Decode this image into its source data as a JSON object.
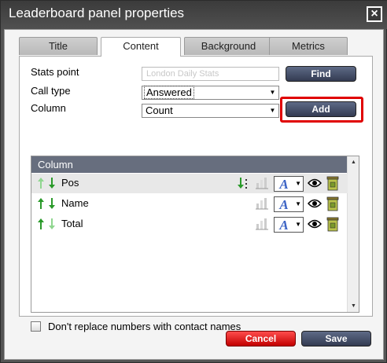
{
  "window": {
    "title": "Leaderboard panel properties",
    "close_label": "×"
  },
  "tabs": [
    {
      "label": "Title"
    },
    {
      "label": "Content"
    },
    {
      "label": "Background"
    },
    {
      "label": "Metrics"
    }
  ],
  "form": {
    "stats_point_label": "Stats point",
    "stats_point_placeholder": "London Daily Stats",
    "find_label": "Find",
    "call_type_label": "Call type",
    "call_type_value": "Answered",
    "column_label": "Column",
    "column_value": "Count",
    "add_label": "Add"
  },
  "grid": {
    "header": "Column",
    "rows": [
      {
        "label": "Pos"
      },
      {
        "label": "Name"
      },
      {
        "label": "Total"
      }
    ],
    "font_glyph": "A"
  },
  "checkbox": {
    "label": "Don't replace numbers with contact names",
    "checked": false
  },
  "footer": {
    "cancel_label": "Cancel",
    "save_label": "Save"
  },
  "colors": {
    "accent": "#e00000",
    "button_dark": "#3a425a",
    "cancel_red": "#e00000",
    "grid_header": "#676e7e"
  }
}
